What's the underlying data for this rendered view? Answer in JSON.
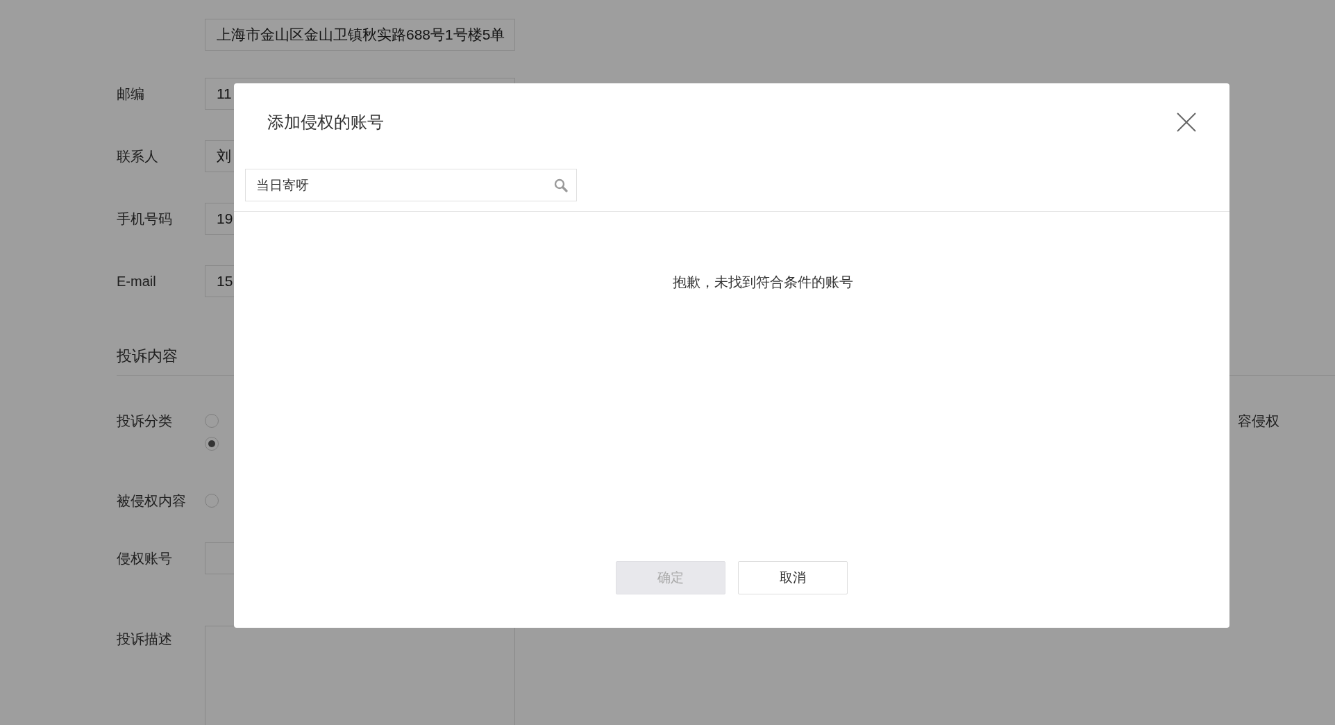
{
  "form": {
    "address_value": "上海市金山区金山卫镇秋实路688号1号楼5单",
    "fields": [
      {
        "label": "邮编",
        "value": "11"
      },
      {
        "label": "联系人",
        "value": "刘"
      },
      {
        "label": "手机号码",
        "value": "19"
      },
      {
        "label": "E-mail",
        "value": "15"
      }
    ],
    "section_title": "投诉内容",
    "category": {
      "label": "投诉分类",
      "options": [
        {
          "selected": false
        },
        {
          "selected": true
        }
      ],
      "tail_text": "容侵权"
    },
    "infringed_content": {
      "label": "被侵权内容",
      "options": [
        {
          "selected": false
        }
      ]
    },
    "account": {
      "label": "侵权账号"
    },
    "description": {
      "label": "投诉描述"
    }
  },
  "dialog": {
    "title": "添加侵权的账号",
    "search": {
      "value": "当日寄呀"
    },
    "empty_message": "抱歉，未找到符合条件的账号",
    "buttons": [
      {
        "label": "确定",
        "disabled": true
      },
      {
        "label": "取消",
        "disabled": false
      }
    ]
  }
}
